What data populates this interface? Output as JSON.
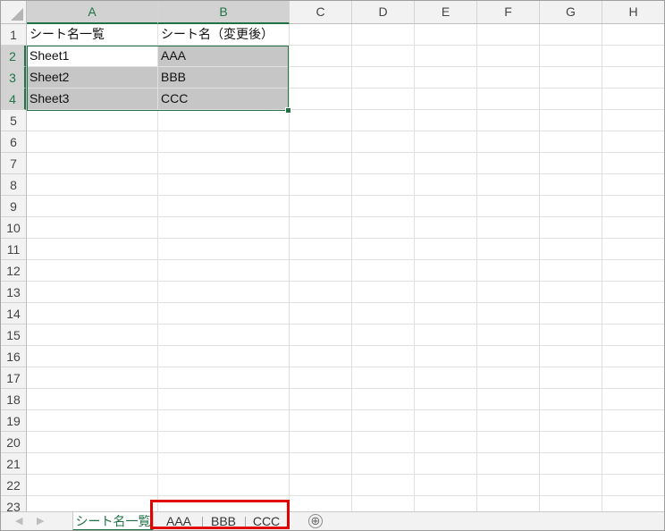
{
  "columns": [
    "A",
    "B",
    "C",
    "D",
    "E",
    "F",
    "G",
    "H"
  ],
  "rows": [
    "1",
    "2",
    "3",
    "4",
    "5",
    "6",
    "7",
    "8",
    "9",
    "10",
    "11",
    "12",
    "13",
    "14",
    "15",
    "16",
    "17",
    "18",
    "19",
    "20",
    "21",
    "22",
    "23"
  ],
  "cells": {
    "A1": "シート名一覧",
    "B1": "シート名（変更後）",
    "A2": "Sheet1",
    "B2": "AAA",
    "A3": "Sheet2",
    "B3": "BBB",
    "A4": "Sheet3",
    "B4": "CCC"
  },
  "sheet_tabs": {
    "active": "シート名一覧",
    "others": [
      "AAA",
      "BBB",
      "CCC"
    ],
    "add_icon": "⊕"
  },
  "nav_icons": {
    "prev": "◀",
    "next": "▶"
  },
  "colors": {
    "accent": "#217346",
    "selection_fill": "#c6c6c6",
    "highlight_box": "#e00000"
  }
}
